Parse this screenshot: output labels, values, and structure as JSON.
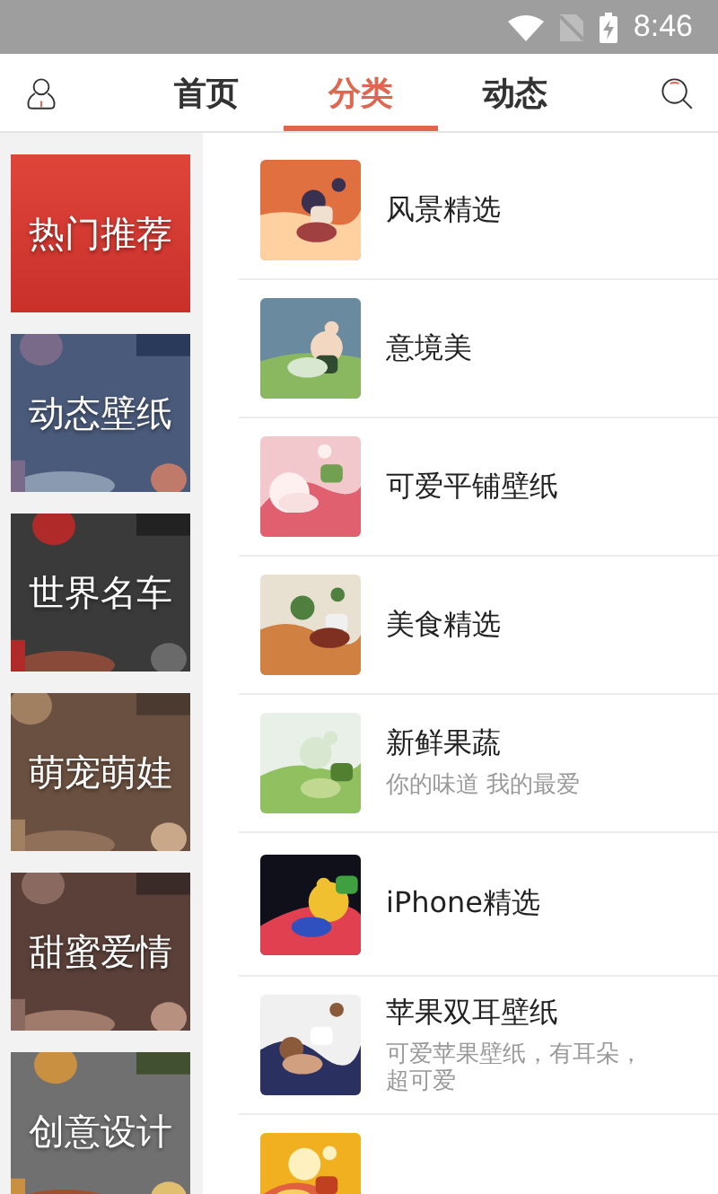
{
  "status_bar": {
    "time": "8:46"
  },
  "nav": {
    "tabs": [
      {
        "label": "首页",
        "selected": false
      },
      {
        "label": "分类",
        "selected": true
      },
      {
        "label": "动态",
        "selected": false
      }
    ]
  },
  "categories": [
    {
      "label": "热门推荐",
      "selected": true
    },
    {
      "label": "动态壁纸",
      "selected": false
    },
    {
      "label": "世界名车",
      "selected": false
    },
    {
      "label": "萌宠萌娃",
      "selected": false
    },
    {
      "label": "甜蜜爱情",
      "selected": false
    },
    {
      "label": "创意设计",
      "selected": false
    }
  ],
  "albums": [
    {
      "kind": "album",
      "title": "风景精选"
    },
    {
      "kind": "album",
      "title": "意境美"
    },
    {
      "kind": "album",
      "title": "可爱平铺壁纸"
    },
    {
      "kind": "album",
      "title": "美食精选"
    },
    {
      "kind": "album",
      "title": "新鲜果蔬",
      "subtitle": "你的味道 我的最爱"
    },
    {
      "kind": "album",
      "title": "iPhone精选"
    },
    {
      "kind": "album",
      "title": "苹果双耳壁纸",
      "subtitle": "可爱苹果壁纸，有耳朵，超可爱"
    },
    {
      "kind": "picture"
    }
  ]
}
